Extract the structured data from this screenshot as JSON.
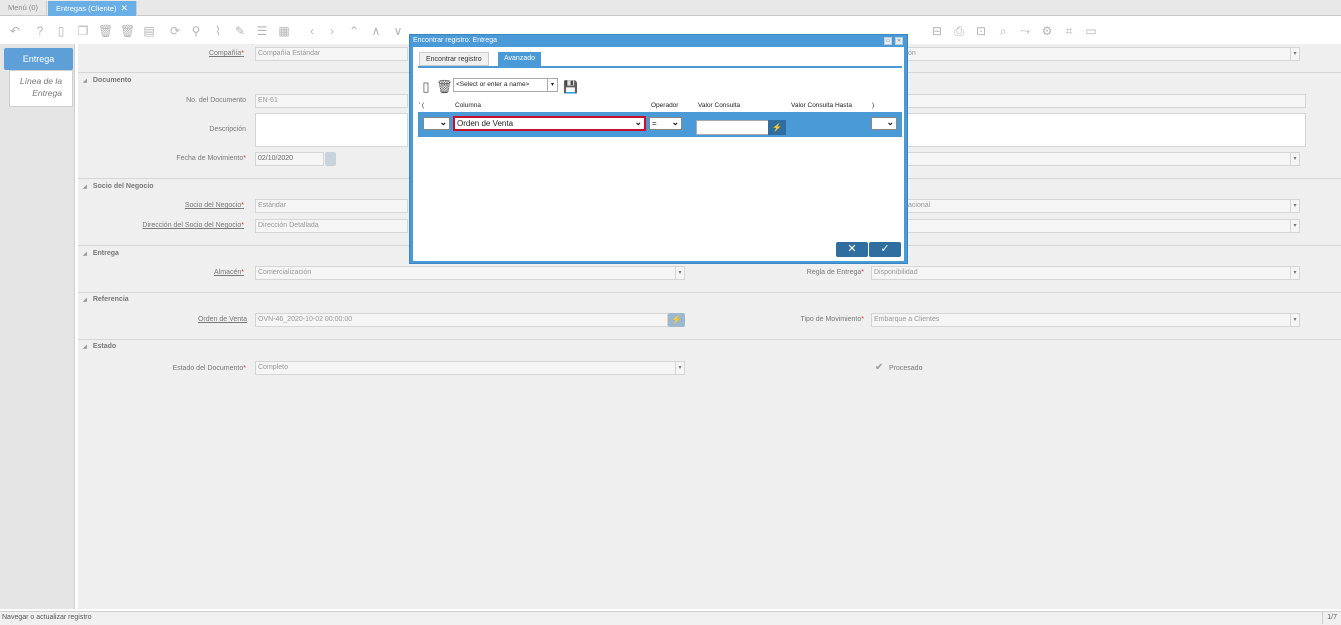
{
  "app_tabs": [
    {
      "label": "Menú (0)"
    },
    {
      "label": "Entregas (Cliente)"
    }
  ],
  "left_tabs": {
    "entrega": "Entrega",
    "linea": "Línea de la Entrega"
  },
  "sections": {
    "documento": "Documento",
    "socio": "Socio del Negocio",
    "entrega": "Entrega",
    "referencia": "Referencia",
    "estado": "Estado"
  },
  "fields": {
    "compania_label": "Compañía",
    "compania_value": "Compañía Estándar",
    "no_doc_label": "No. del Documento",
    "no_doc_value": "EN-61",
    "descripcion_label": "Descripción",
    "fecha_label": "Fecha de Movimiento",
    "fecha_value": "02/10/2020",
    "socio_label": "Socio del Negocio",
    "socio_value": "Estándar",
    "direccion_label": "Dirección del Socio del Negocio",
    "direccion_value": "Dirección Detallada",
    "almacen_label": "Almacén",
    "almacen_value": "Comercialización",
    "regla_label": "Regla de Entrega",
    "regla_value": "Disponibilidad",
    "orden_label": "Orden de Venta",
    "orden_value": "OVN-46_2020-10-02 00:00:00",
    "tipo_mov_label": "Tipo de Movimiento",
    "tipo_mov_value": "Embarque a Clientes",
    "estado_doc_label": "Estado del Documento",
    "estado_doc_value": "Completo",
    "procesado_label": "Procesado",
    "right_partial_1": "ón",
    "right_partial_2": "acional"
  },
  "dialog": {
    "title": "Encontrar registro: Entrega",
    "tab_find": "Encontrar registro",
    "tab_advanced": "Avanzado",
    "name_placeholder": "<Select or enter a name>",
    "columns": {
      "paren_open": "' (",
      "columna": "Columna",
      "operador": "Operador",
      "valor": "Valor Consulta",
      "valor_hasta": "Valor Consulta Hasta",
      "paren_close": ")"
    },
    "row": {
      "columna_value": "Orden de Venta",
      "operador_value": "="
    }
  },
  "status": {
    "message": "Navegar o actualizar registro",
    "counter": "1/7"
  },
  "colors": {
    "accent": "#4a9ad8",
    "button_dark": "#2f6e9e",
    "required": "#d32f2f",
    "highlight_border": "#c8102e"
  }
}
